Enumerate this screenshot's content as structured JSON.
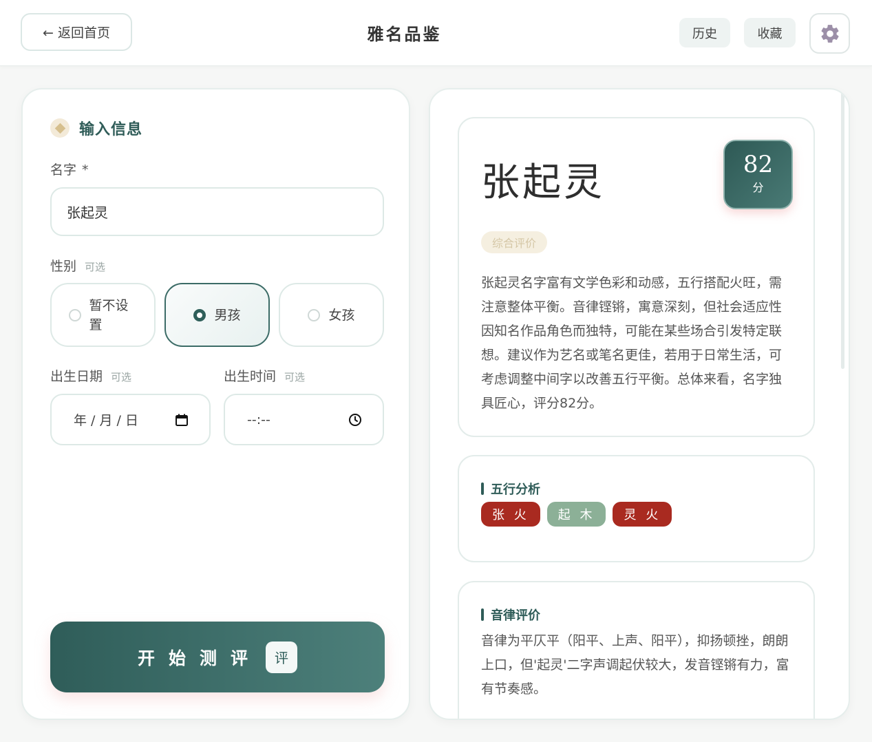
{
  "header": {
    "back_label": "← 返回首页",
    "title": "雅名品鉴",
    "history_label": "历史",
    "favorite_label": "收藏"
  },
  "form": {
    "section_title": "输入信息",
    "name_label": "名字",
    "name_required": "*",
    "name_value": "张起灵",
    "gender_label": "性别",
    "gender_optional": "可选",
    "gender_options": [
      "暂不设置",
      "男孩",
      "女孩"
    ],
    "gender_selected": "男孩",
    "birth_date_label": "出生日期",
    "birth_date_optional": "可选",
    "birth_date_placeholder": "年 / 月 / 日",
    "birth_time_label": "出生时间",
    "birth_time_optional": "可选",
    "birth_time_placeholder": "--:--",
    "submit_label": "开始测评",
    "submit_badge": "评"
  },
  "result": {
    "name": "张起灵",
    "score": "82",
    "score_unit": "分",
    "overall_tag": "综合评价",
    "overall_text": "张起灵名字富有文学色彩和动感，五行搭配火旺，需注意整体平衡。音律铿锵，寓意深刻，但社会适应性因知名作品角色而独特，可能在某些场合引发特定联想。建议作为艺名或笔名更佳，若用于日常生活，可考虑调整中间字以改善五行平衡。总体来看，名字独具匠心，评分82分。",
    "wuxing_title": "五行分析",
    "wuxing": [
      {
        "label": "张 火",
        "element": "fire",
        "color": "#a92a20"
      },
      {
        "label": "起 木",
        "element": "wood",
        "color": "#8cb097"
      },
      {
        "label": "灵 火",
        "element": "fire",
        "color": "#a92a20"
      }
    ],
    "yinlv_title": "音律评价",
    "yinlv_text": "音律为平仄平（阳平、上声、阳平），抑扬顿挫，朗朗上口，但'起灵'二字声调起伏较大，发音铿锵有力，富有节奏感。"
  },
  "colors": {
    "accent": "#2f5c58",
    "fire": "#a92a20",
    "wood": "#8cb097"
  }
}
